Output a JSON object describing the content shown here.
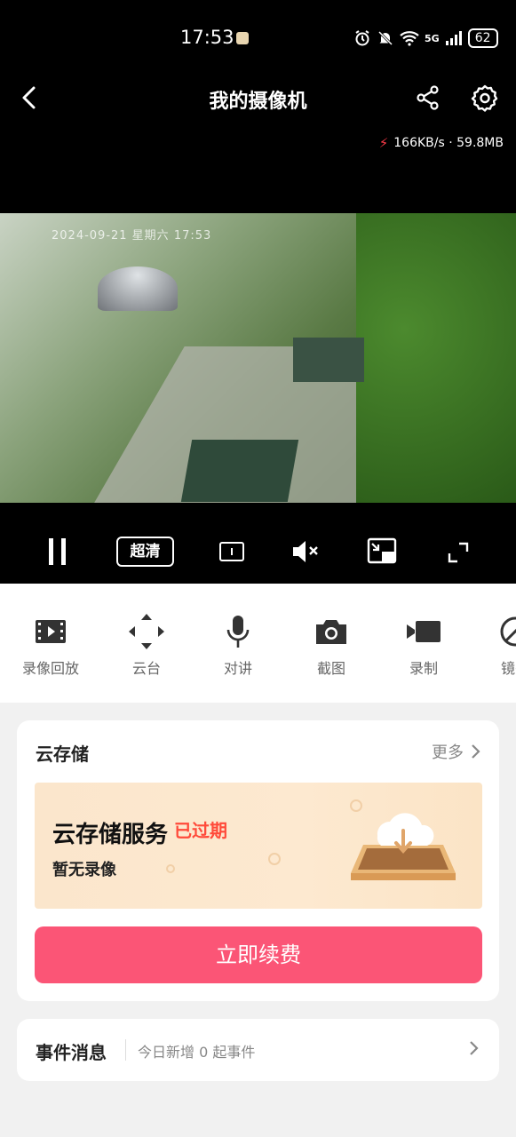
{
  "status_bar": {
    "time": "17:53",
    "network": "5G",
    "battery": "62"
  },
  "nav": {
    "title": "我的摄像机"
  },
  "netspeed": {
    "text": "166KB/s · 59.8MB"
  },
  "video": {
    "timestamp": "2024-09-21  星期六  17:53"
  },
  "controls": {
    "quality": "超清"
  },
  "toolbar": {
    "items": [
      {
        "label": "录像回放",
        "icon": "film-icon"
      },
      {
        "label": "云台",
        "icon": "ptz-arrows-icon"
      },
      {
        "label": "对讲",
        "icon": "microphone-icon"
      },
      {
        "label": "截图",
        "icon": "camera-icon"
      },
      {
        "label": "录制",
        "icon": "video-record-icon"
      },
      {
        "label": "镜头",
        "icon": "lens-icon"
      }
    ]
  },
  "cloud": {
    "title": "云存储",
    "more": "更多",
    "banner_title": "云存储服务",
    "banner_status": "已过期",
    "banner_subtitle": "暂无录像",
    "renew_button": "立即续费"
  },
  "events": {
    "title": "事件消息",
    "summary": "今日新增 0 起事件"
  },
  "colors": {
    "accent": "#fb5576",
    "expired": "#ff4a3a"
  }
}
